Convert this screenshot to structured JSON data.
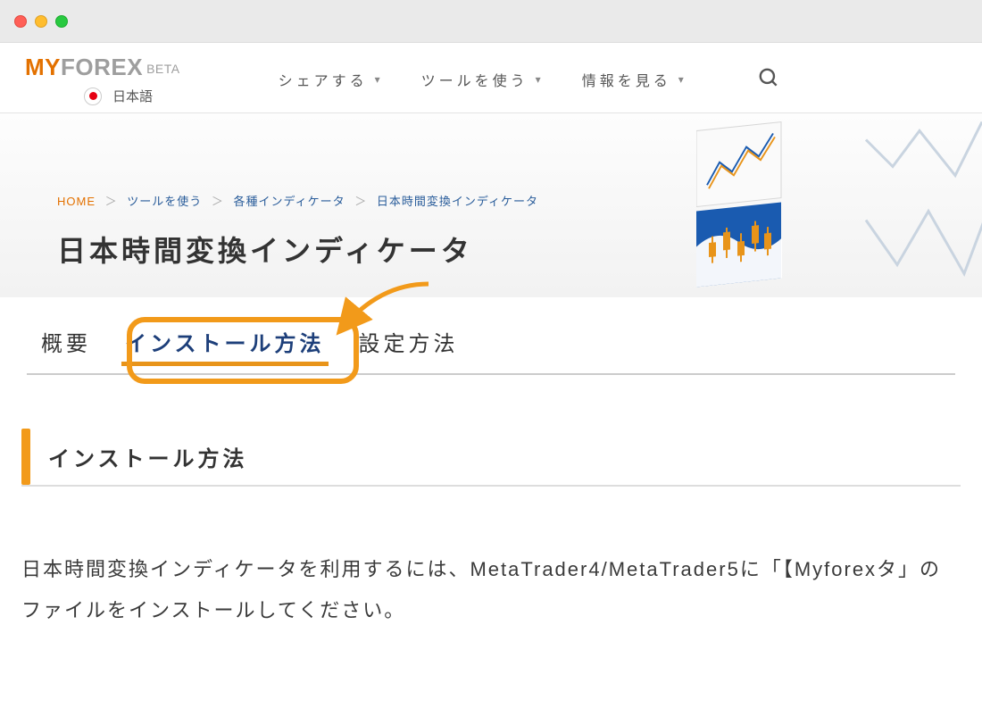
{
  "header": {
    "logo_my": "MY",
    "logo_forex": "FOREX",
    "logo_beta": "BETA",
    "lang_label": "日本語"
  },
  "nav": {
    "items": [
      {
        "label": "シェアする"
      },
      {
        "label": "ツールを使う"
      },
      {
        "label": "情報を見る"
      }
    ]
  },
  "breadcrumb": {
    "home": "HOME",
    "items": [
      "ツールを使う",
      "各種インディケータ",
      "日本時間変換インディケータ"
    ]
  },
  "page_title": "日本時間変換インディケータ",
  "tabs": {
    "items": [
      {
        "label": "概要",
        "active": false
      },
      {
        "label": "インストール方法",
        "active": true
      },
      {
        "label": "設定方法",
        "active": false
      }
    ]
  },
  "section": {
    "title": "インストール方法",
    "body": "日本時間変換インディケータを利用するには、MetaTrader4/MetaTrader5に「【Myforexタ」のファイルをインストールしてください。"
  },
  "colors": {
    "accent": "#f29a1a",
    "brand_orange": "#e37100",
    "link": "#295c9a"
  }
}
